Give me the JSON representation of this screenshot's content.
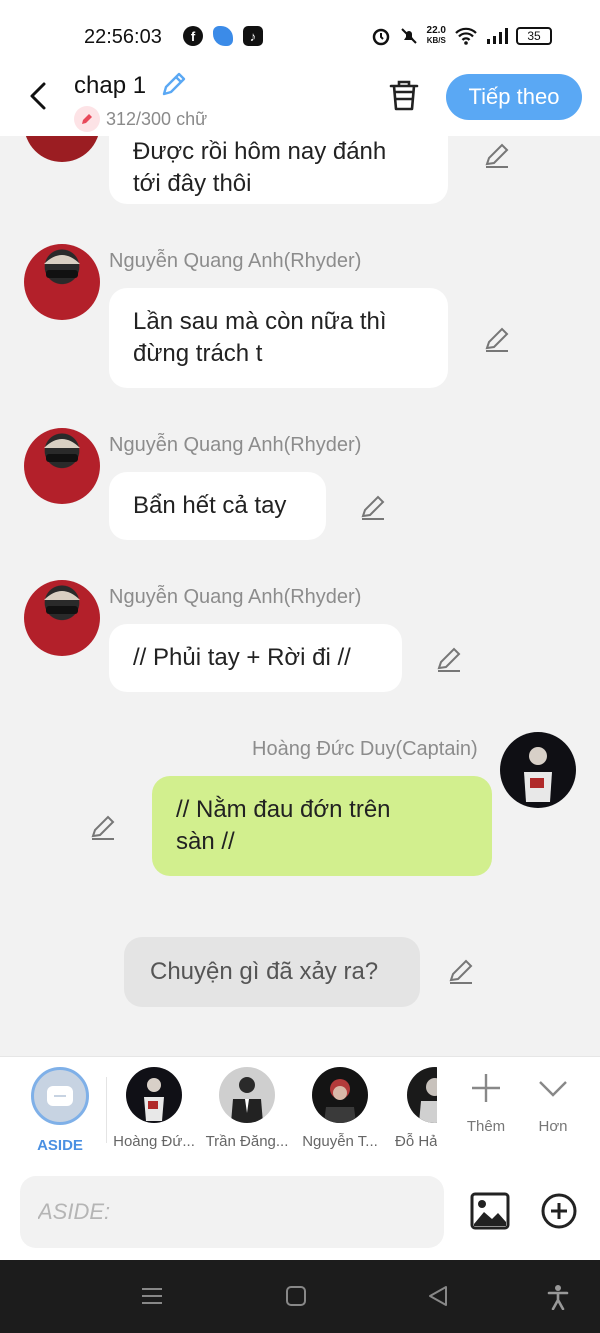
{
  "status_bar": {
    "time": "22:56:03",
    "net_speed": "22.0",
    "net_unit": "KB/S",
    "battery": "35",
    "icons": [
      "facebook-icon",
      "messenger-icon",
      "tiktok-icon",
      "alarm-icon",
      "mute-icon",
      "wifi-icon",
      "signal-icon"
    ]
  },
  "header": {
    "title": "chap 1",
    "word_count": "312/300 chữ",
    "next_label": "Tiếp theo",
    "accent": "#5aa8f4"
  },
  "messages": [
    {
      "type": "left",
      "text_line1": "Được rồi hôm nay đánh",
      "text_line2": "tới đây thôi"
    },
    {
      "type": "left",
      "name": "Nguyễn Quang Anh(Rhyder)",
      "text_line1": "Lần sau mà còn nữa thì",
      "text_line2": "đừng trách t"
    },
    {
      "type": "left",
      "name": "Nguyễn Quang Anh(Rhyder)",
      "text": "Bẩn hết cả tay"
    },
    {
      "type": "left",
      "name": "Nguyễn Quang Anh(Rhyder)",
      "text": "// Phủi tay + Rời đi //"
    },
    {
      "type": "right",
      "name": "Hoàng Đức Duy(Captain)",
      "text_line1": "// Nằm đau đớn trên",
      "text_line2": "sàn //",
      "color": "#d2ef8e"
    },
    {
      "type": "aside",
      "text": "Chuyện gì đã xảy ra?"
    }
  ],
  "character_bar": {
    "items": [
      {
        "label": "ASIDE",
        "selected": true
      },
      {
        "label": "Hoàng Đứ..."
      },
      {
        "label": "Trần Đăng..."
      },
      {
        "label": "Nguyễn T..."
      },
      {
        "label": "Đỗ Hả"
      }
    ],
    "more_label": "Thêm",
    "expand_label": "Hơn"
  },
  "composer": {
    "placeholder": "ASIDE:"
  },
  "nav": {
    "icons": [
      "menu-icon",
      "home-icon",
      "back-icon",
      "accessibility-icon"
    ]
  }
}
